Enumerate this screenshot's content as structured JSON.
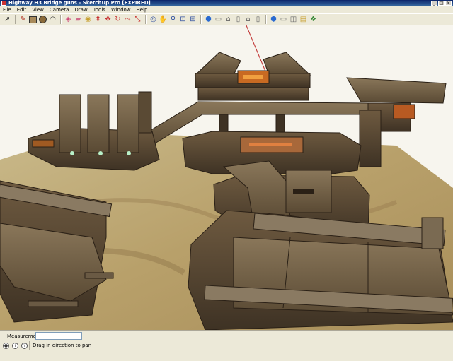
{
  "window": {
    "title": "Highway H3 Bridge guns - SketchUp Pro [EXPIRED]"
  },
  "menu": [
    "File",
    "Edit",
    "View",
    "Camera",
    "Draw",
    "Tools",
    "Window",
    "Help"
  ],
  "toolbar": {
    "groups": [
      [
        "select-icon"
      ],
      [
        "pencil-icon",
        "rectangle-icon",
        "circle-icon",
        "arc-icon"
      ],
      [
        "paint-bucket-icon",
        "eraser-icon",
        "tape-measure-icon",
        "push-pull-icon",
        "move-icon",
        "rotate-icon",
        "follow-me-icon",
        "scale-icon"
      ],
      [
        "orbit-icon",
        "pan-icon",
        "zoom-icon",
        "zoom-window-icon",
        "zoom-extents-icon"
      ],
      [
        "iso-view-icon",
        "top-view-icon",
        "front-view-icon",
        "right-view-icon",
        "back-view-icon",
        "left-view-icon"
      ],
      [
        "get-models-icon",
        "share-model-icon",
        "section-plane-icon",
        "layers-icon",
        "components-icon"
      ]
    ]
  },
  "status": {
    "measurements_label": "Measurements",
    "measurements_value": "",
    "message": "Drag in direction to pan",
    "icons": [
      "geo-icon",
      "credits-icon",
      "help-icon"
    ]
  }
}
